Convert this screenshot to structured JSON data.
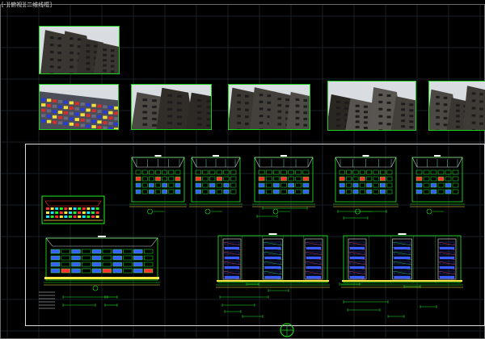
{
  "viewport": {
    "label": "[-][俯视][二维线框]"
  },
  "colors": {
    "background": "#000000",
    "grid": "#1a1f26",
    "frame": "#ffffff",
    "drawing_line": "#22ee22",
    "accent_blue": "#3a5cff",
    "accent_red": "#ff3030",
    "accent_yellow": "#ffe840",
    "accent_cyan": "#20e0ff"
  },
  "photos": [
    {
      "name": "site-photo-1",
      "subject": "building-corner-upward"
    },
    {
      "name": "site-photo-2",
      "subject": "building-facade-colorful"
    },
    {
      "name": "site-photo-3",
      "subject": "building-corner-upward"
    },
    {
      "name": "site-photo-4",
      "subject": "building-corner-upward"
    },
    {
      "name": "site-photo-5",
      "subject": "building-corner-upward"
    },
    {
      "name": "site-photo-6",
      "subject": "building-corner-upward"
    }
  ],
  "icons": {
    "compass": "compass-icon"
  }
}
